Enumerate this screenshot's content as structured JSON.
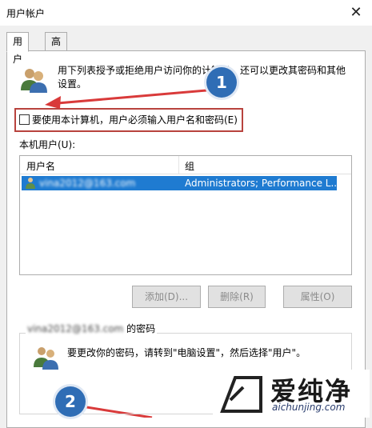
{
  "window": {
    "title": "用户帐户",
    "close_glyph": "✕"
  },
  "tabs": [
    {
      "label": "用户",
      "active": true
    },
    {
      "label": "高级",
      "active": false
    }
  ],
  "intro_text": "用下列表授予或拒绝用户访问你的计算机，还可以更改其密码和其他设置。",
  "require_password_checkbox": {
    "label": "要使用本计算机，用户必须输入用户名和密码(E)",
    "checked": false
  },
  "annotations": {
    "badge1": "1",
    "badge2": "2",
    "accent_color": "#d93a3a",
    "badge_color": "#2f6db5"
  },
  "local_users": {
    "label": "本机用户(U):",
    "columns": [
      "用户名",
      "组"
    ],
    "rows": [
      {
        "name": "vina2012@163.com",
        "group": "Administrators; Performance L...",
        "selected": true
      }
    ]
  },
  "buttons": {
    "add": "添加(D)...",
    "remove": "删除(R)",
    "properties": "属性(O)"
  },
  "password_group": {
    "title_user": "vina2012@163.com",
    "title_suffix": " 的密码",
    "text": "要更改你的密码，请转到\"电脑设置\"，然后选择\"用户\"。"
  },
  "watermark": {
    "brand": "爱纯净",
    "url": "aichunjing.com"
  }
}
